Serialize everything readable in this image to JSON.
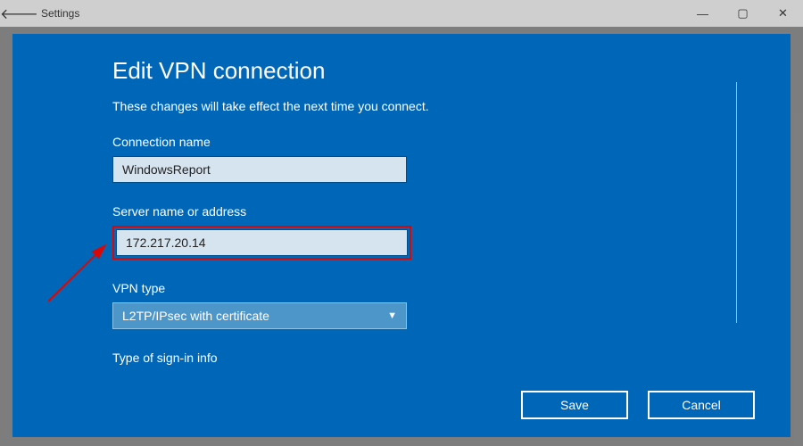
{
  "titleBar": {
    "title": "Settings"
  },
  "modal": {
    "title": "Edit VPN connection",
    "subtitle": "These changes will take effect the next time you connect."
  },
  "form": {
    "connectionName": {
      "label": "Connection name",
      "value": "WindowsReport"
    },
    "serverAddress": {
      "label": "Server name or address",
      "value": "172.217.20.14"
    },
    "vpnType": {
      "label": "VPN type",
      "value": "L2TP/IPsec with certificate"
    },
    "signInType": {
      "label": "Type of sign-in info"
    }
  },
  "buttons": {
    "save": "Save",
    "cancel": "Cancel"
  }
}
